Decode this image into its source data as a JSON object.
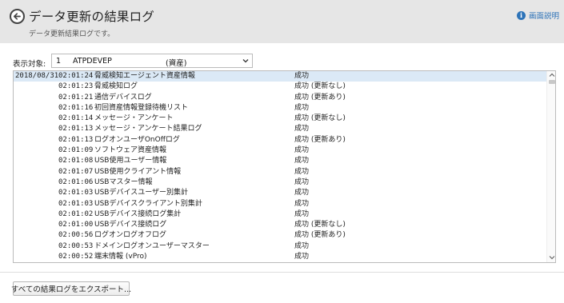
{
  "header": {
    "title": "データ更新の結果ログ",
    "subtitle": "データ更新結果ログです。",
    "help_label": "画面説明",
    "back_icon": "back-arrow-icon",
    "help_icon": "info-icon"
  },
  "target": {
    "label": "表示対象:",
    "selected_id": "1",
    "selected_name": "ATPDEVEP",
    "selected_type": "(資産)"
  },
  "log": {
    "rows": [
      {
        "date": "2018/08/31",
        "time": "02:01:24",
        "name": "脅威検知エージェント資産情報",
        "result": "成功"
      },
      {
        "date": "",
        "time": "02:01:23",
        "name": "脅威検知ログ",
        "result": "成功 (更新なし)"
      },
      {
        "date": "",
        "time": "02:01:21",
        "name": "通信デバイスログ",
        "result": "成功 (更新あり)"
      },
      {
        "date": "",
        "time": "02:01:16",
        "name": "初回資産情報登録待機リスト",
        "result": "成功"
      },
      {
        "date": "",
        "time": "02:01:14",
        "name": "メッセージ・アンケート",
        "result": "成功 (更新なし)"
      },
      {
        "date": "",
        "time": "02:01:13",
        "name": "メッセージ・アンケート結果ログ",
        "result": "成功"
      },
      {
        "date": "",
        "time": "02:01:13",
        "name": "ログオンユーザOnOffログ",
        "result": "成功 (更新あり)"
      },
      {
        "date": "",
        "time": "02:01:09",
        "name": "ソフトウェア資産情報",
        "result": "成功"
      },
      {
        "date": "",
        "time": "02:01:08",
        "name": "USB使用ユーザー情報",
        "result": "成功"
      },
      {
        "date": "",
        "time": "02:01:07",
        "name": "USB使用クライアント情報",
        "result": "成功"
      },
      {
        "date": "",
        "time": "02:01:06",
        "name": "USBマスター情報",
        "result": "成功"
      },
      {
        "date": "",
        "time": "02:01:03",
        "name": "USBデバイスユーザー別集計",
        "result": "成功"
      },
      {
        "date": "",
        "time": "02:01:03",
        "name": "USBデバイスクライアント別集計",
        "result": "成功"
      },
      {
        "date": "",
        "time": "02:01:02",
        "name": "USBデバイス接続ログ集計",
        "result": "成功"
      },
      {
        "date": "",
        "time": "02:01:00",
        "name": "USBデバイス接続ログ",
        "result": "成功 (更新なし)"
      },
      {
        "date": "",
        "time": "02:00:56",
        "name": "ログオンログオフログ",
        "result": "成功 (更新あり)"
      },
      {
        "date": "",
        "time": "02:00:53",
        "name": "ドメインログオンユーザーマスター",
        "result": "成功"
      },
      {
        "date": "",
        "time": "02:00:52",
        "name": "端末情報 (vPro)",
        "result": "成功"
      }
    ]
  },
  "footer": {
    "export_label": "すべての結果ログをエクスポート..."
  },
  "colors": {
    "header_bg": "#e6e6e6",
    "link_blue": "#2d73b8",
    "selected_row": "#dbe9f6"
  }
}
